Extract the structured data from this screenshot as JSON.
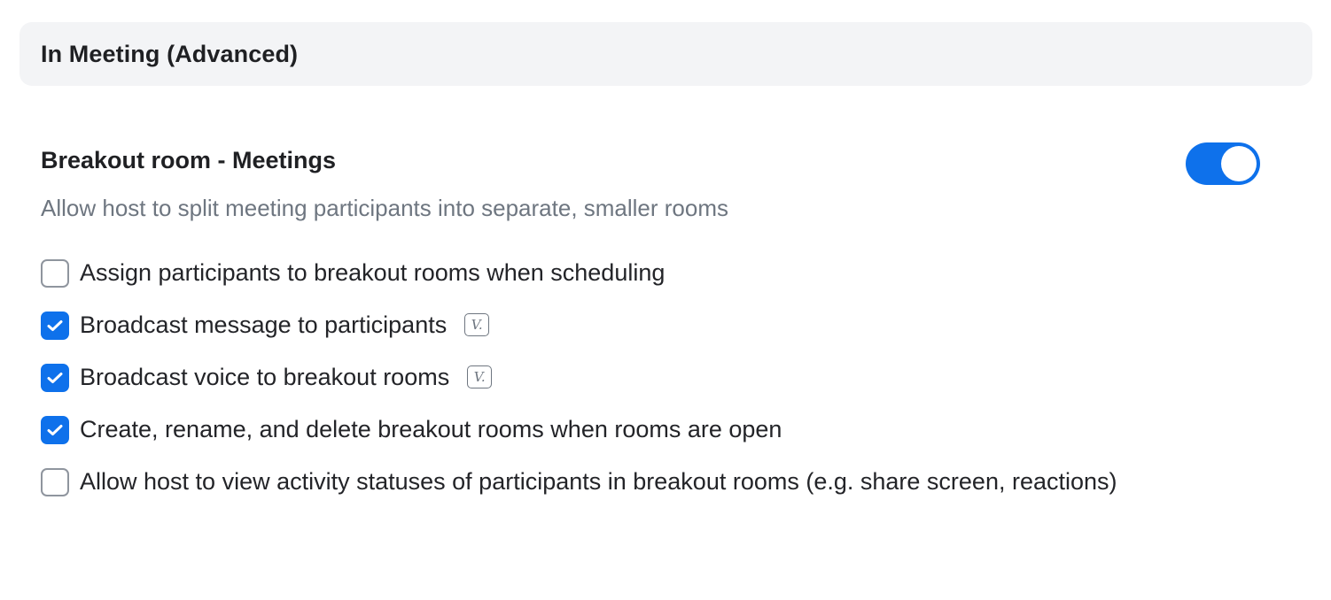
{
  "section": {
    "title": "In Meeting (Advanced)"
  },
  "setting": {
    "title": "Breakout room - Meetings",
    "description": "Allow host to split meeting participants into separate, smaller rooms",
    "enabled": true,
    "toggle_color": "#0e71eb"
  },
  "options": [
    {
      "label": "Assign participants to breakout rooms when scheduling",
      "checked": false
    },
    {
      "label": "Broadcast message to participants",
      "checked": true,
      "badge": "V."
    },
    {
      "label": "Broadcast voice to breakout rooms",
      "checked": true,
      "badge": "V."
    },
    {
      "label": "Create, rename, and delete breakout rooms when rooms are open",
      "checked": true
    },
    {
      "label": "Allow host to view activity statuses of participants in breakout rooms (e.g. share screen, reactions)",
      "checked": false
    }
  ],
  "colors": {
    "accent": "#0e71eb",
    "header_bg": "#f3f4f6",
    "muted_text": "#6e7680"
  }
}
